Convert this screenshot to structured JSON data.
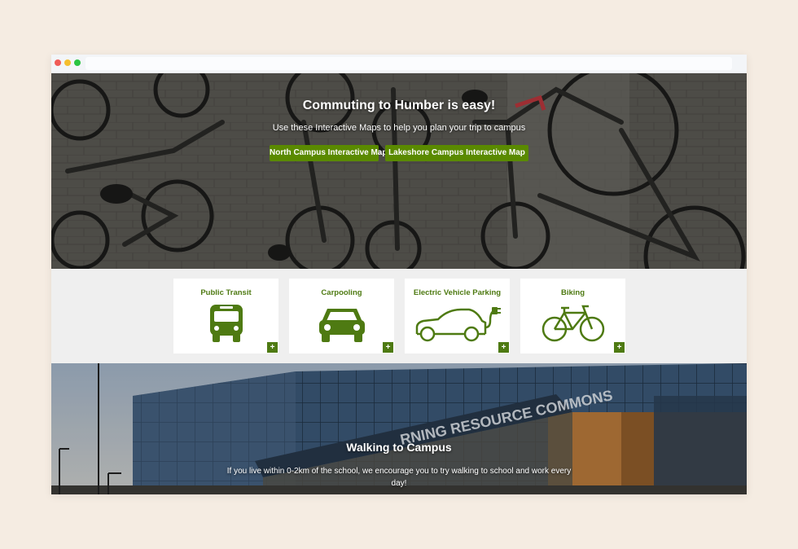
{
  "hero": {
    "title": "Commuting to Humber is easy!",
    "subtitle": "Use these Interactive Maps to help you plan your trip to campus",
    "buttons": [
      {
        "label": "North Campus Interactive Map"
      },
      {
        "label": "Lakeshore Campus Interactive Map"
      }
    ]
  },
  "options": [
    {
      "title": "Public Transit",
      "icon": "bus-icon",
      "expand": "+"
    },
    {
      "title": "Carpooling",
      "icon": "car-icon",
      "expand": "+"
    },
    {
      "title": "Electric Vehicle Parking",
      "icon": "electric-car-icon",
      "expand": "+"
    },
    {
      "title": "Biking",
      "icon": "bicycle-icon",
      "expand": "+"
    }
  ],
  "walking": {
    "title": "Walking to Campus",
    "text": "If you live within 0-2km of the school, we encourage you to try walking to school and work every day!"
  },
  "colors": {
    "accent": "#5a8a00",
    "icon_green": "#4e7a12",
    "page_bg": "#f5ece2"
  }
}
